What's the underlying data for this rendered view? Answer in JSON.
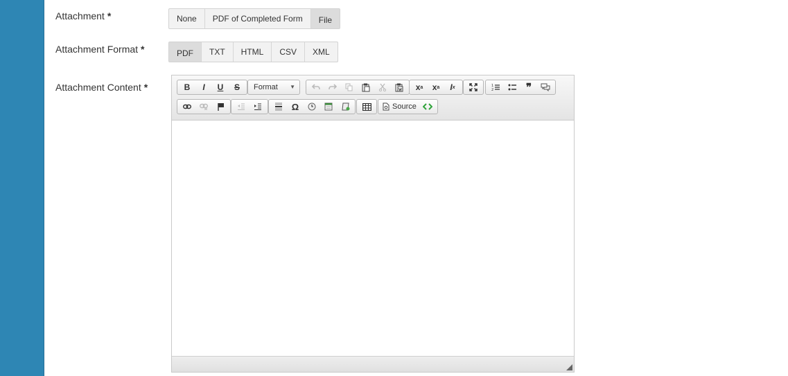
{
  "attachment": {
    "label": "Attachment",
    "required": "*",
    "options": [
      "None",
      "PDF of Completed Form",
      "File"
    ],
    "selected": "File"
  },
  "attachment_format": {
    "label": "Attachment Format",
    "required": "*",
    "options": [
      "PDF",
      "TXT",
      "HTML",
      "CSV",
      "XML"
    ],
    "selected": "PDF"
  },
  "attachment_content": {
    "label": "Attachment Content",
    "required": "*",
    "toolbar": {
      "format_label": "Format",
      "source_label": "Source",
      "bold": "B",
      "italic": "I",
      "underline": "U",
      "strike": "S",
      "special_char": "Ω"
    },
    "body_text": ""
  },
  "colors": {
    "sidebar": "#2e86b4",
    "source_arrows": "#2fa33a"
  }
}
